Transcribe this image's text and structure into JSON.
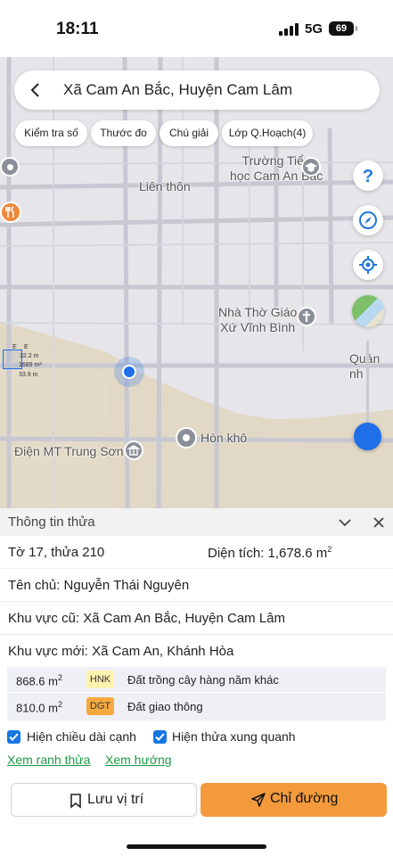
{
  "status": {
    "time": "18:11",
    "network": "5G",
    "battery": "69"
  },
  "header": {
    "title": "Xã Cam An Bắc, Huyện Cam Lâm"
  },
  "chips": [
    "Kiểm tra số",
    "Thước đo",
    "Chú giải",
    "Lớp Q.Hoạch(4)"
  ],
  "map_labels": {
    "school": "Trường Tiểu học Cam An Bắc",
    "school_l1": "Trường Tiểu",
    "school_l2": "học Cam An Bắc",
    "lien_thon": "Liên thôn",
    "church_l1": "Nhà Thờ Giáo",
    "church_l2": "Xứ Vĩnh Bình",
    "quan_nhi": "Quán nh",
    "hon_kho": "Hòn khô",
    "dien_mt": "Điện MT Trung Sơn",
    "parcel_e1": "E",
    "parcel_e2": "E",
    "parcel_32": "32.2 m",
    "parcel_area": "1689 m²",
    "parcel_33": "33.9 m"
  },
  "panel": {
    "title": "Thông tin thửa",
    "sheet": "Tờ 17, thửa 210",
    "area_label": "Diện tích: 1,678.6 m",
    "area_sup": "2",
    "owner": "Tên chủ: Nguyễn Thái Nguyên",
    "old_region": "Khu vực cũ: Xã Cam An Bắc, Huyện Cam Lâm",
    "new_region": "Khu vực mới: Xã Cam An, Khánh Hòa",
    "land_uses": [
      {
        "area": "868.6 m",
        "sup": "2",
        "code": "HNK",
        "desc": "Đất trồng cây hàng năm khác",
        "color": "#fff3b0"
      },
      {
        "area": "810.0 m",
        "sup": "2",
        "code": "DGT",
        "desc": "Đất giao thông",
        "color": "#f6a93f"
      }
    ],
    "checkbox_edges": "Hiện chiều dài cạnh",
    "checkbox_neighbors": "Hiện thửa xung quanh",
    "link_boundary": "Xem ranh thửa",
    "link_direction": "Xem hướng",
    "save_label": "Lưu vị trí",
    "route_label": "Chỉ đường"
  },
  "colors": {
    "accent": "#f39a3c",
    "link": "#1f9a45",
    "checkbox": "#1677e0",
    "location": "#1f6fe8"
  }
}
